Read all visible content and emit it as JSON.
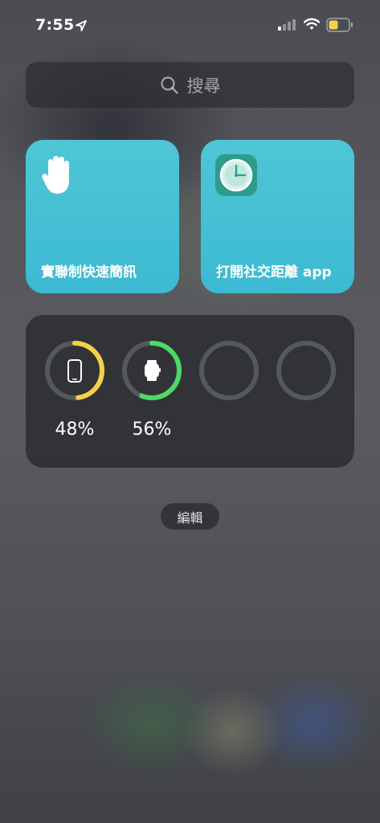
{
  "status_bar": {
    "time": "7:55",
    "icons": [
      "location-arrow-icon",
      "cellular-signal-icon",
      "wifi-icon",
      "battery-icon"
    ],
    "battery_color": "#f5d14a"
  },
  "search": {
    "placeholder": "搜尋",
    "icon": "search-icon"
  },
  "shortcuts": [
    {
      "label": "實聯制快速簡訊",
      "icon": "hand-icon",
      "color": "#45c0d4"
    },
    {
      "label": "打開社交距離 app",
      "icon": "clock-app-icon",
      "color": "#45c0d4"
    }
  ],
  "batteries": {
    "devices": [
      {
        "device": "iphone",
        "icon": "iphone-icon",
        "level": 0.48,
        "label": "48%",
        "color": "#f5d14a"
      },
      {
        "device": "watch",
        "icon": "watch-icon",
        "level": 0.56,
        "label": "56%",
        "color": "#4cd964"
      },
      {
        "device": "empty",
        "level": null
      },
      {
        "device": "empty",
        "level": null
      }
    ]
  },
  "edit_button": {
    "label": "編輯"
  }
}
